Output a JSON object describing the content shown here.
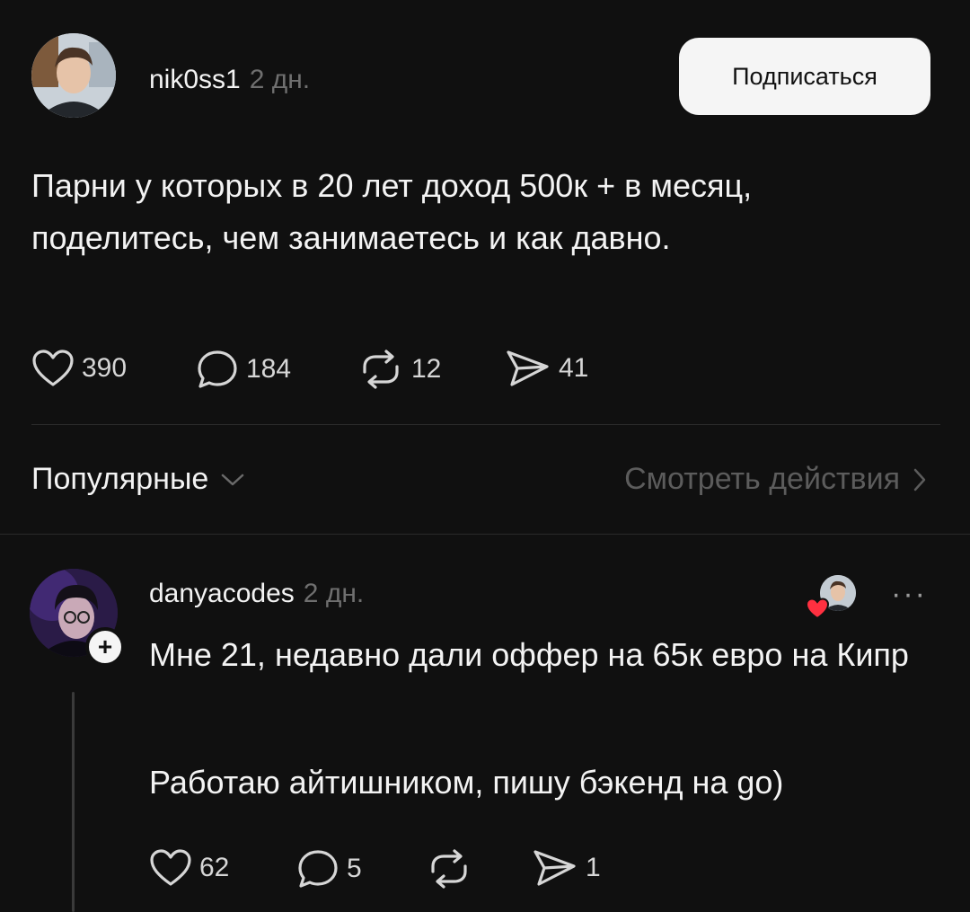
{
  "post": {
    "username": "nik0ss1",
    "time": "2 дн.",
    "follow_label": "Подписаться",
    "text": "Парни у которых в 20 лет доход 500к + в месяц, поделитесь, чем занимаетесь и как давно.",
    "likes": "390",
    "comments": "184",
    "reposts": "12",
    "shares": "41"
  },
  "replies_header": {
    "sort_label": "Популярные",
    "view_activity_label": "Смотреть действия"
  },
  "reply": {
    "username": "danyacodes",
    "time": "2 дн.",
    "plus": "+",
    "more": "···",
    "text_line1": "Мне 21, недавно дали оффер на 65к евро на Кипр",
    "text_line2": "Работаю айтишником, пишу бэкенд на go)",
    "likes": "62",
    "comments": "5",
    "shares": "1"
  },
  "icons": {
    "like": "heart-icon",
    "comment": "comment-icon",
    "repost": "repost-icon",
    "share": "share-icon",
    "chevron_down": "chevron-down-icon",
    "chevron_right": "chevron-right-icon"
  },
  "colors": {
    "background": "#101010",
    "text": "#f3f3f3",
    "muted": "#6f6f6f",
    "button_bg": "#f5f5f5",
    "heart_badge": "#ff3040"
  }
}
